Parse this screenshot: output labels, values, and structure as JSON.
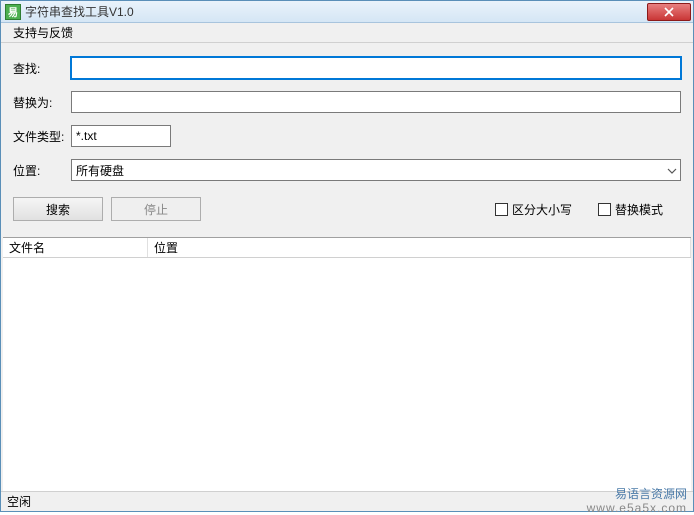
{
  "window": {
    "title": "字符串查找工具V1.0"
  },
  "menu": {
    "support": "支持与反馈"
  },
  "form": {
    "search_label": "查找:",
    "search_value": "",
    "replace_label": "替换为:",
    "replace_value": "",
    "filetype_label": "文件类型:",
    "filetype_value": "*.txt",
    "location_label": "位置:",
    "location_value": "所有硬盘"
  },
  "buttons": {
    "search": "搜索",
    "stop": "停止"
  },
  "checkboxes": {
    "case_sensitive": "区分大小写",
    "replace_mode": "替换模式"
  },
  "results": {
    "col_filename": "文件名",
    "col_location": "位置"
  },
  "status": {
    "text": "空闲"
  },
  "watermark": {
    "line1": "易语言资源网",
    "line2": "www.e5a5x.com"
  }
}
